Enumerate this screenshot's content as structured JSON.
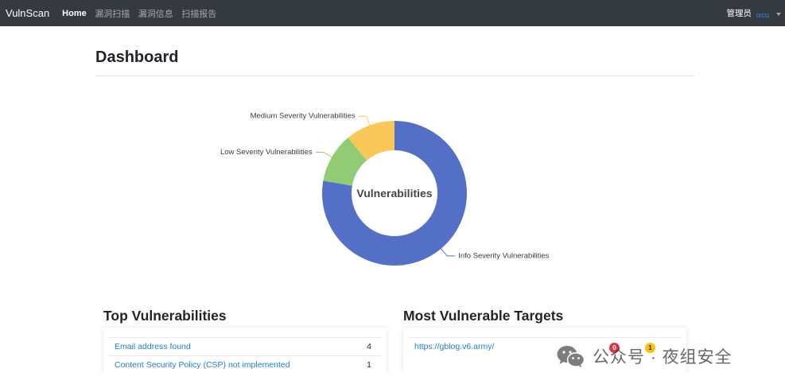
{
  "navbar": {
    "brand": "VulnScan",
    "items": [
      {
        "label": "Home",
        "active": true
      },
      {
        "label": "漏洞扫描",
        "active": false
      },
      {
        "label": "漏洞信息",
        "active": false
      },
      {
        "label": "扫描报告",
        "active": false
      }
    ],
    "user_role": "管理员",
    "username": "ixcu",
    "dropdown_icon": "caret-down-icon",
    "colors": {
      "background": "#343a40",
      "username": "#2a8cf0"
    }
  },
  "page": {
    "title": "Dashboard"
  },
  "chart_data": {
    "type": "pie",
    "style": "donut",
    "title": "Vulnerabilities",
    "categories": [
      "Info Severity Vulnerabilities",
      "Low Severity Vulnerabilities",
      "Medium Severity Vulnerabilities"
    ],
    "values": [
      7,
      1,
      1
    ],
    "colors": [
      "#5470c6",
      "#91cc75",
      "#fac858"
    ]
  },
  "top_vulnerabilities": {
    "title": "Top Vulnerabilities",
    "items": [
      {
        "name": "Email address found",
        "count": "4"
      },
      {
        "name": "Content Security Policy (CSP) not implemented",
        "count": "1"
      }
    ]
  },
  "most_vulnerable_targets": {
    "title": "Most Vulnerable Targets",
    "items": [
      {
        "target": "https://gblog.v6.army/",
        "badges": [
          {
            "value": "0",
            "color": "#dc3545",
            "text_color": "#ffffff"
          },
          {
            "value": "1",
            "color": "#ffc107",
            "text_color": "#212529"
          }
        ]
      }
    ]
  },
  "watermark": {
    "text": "公众号 · 夜组安全",
    "icon": "wechat-icon"
  },
  "colors": {
    "link": "#1e7fd6",
    "text": "#212529"
  }
}
